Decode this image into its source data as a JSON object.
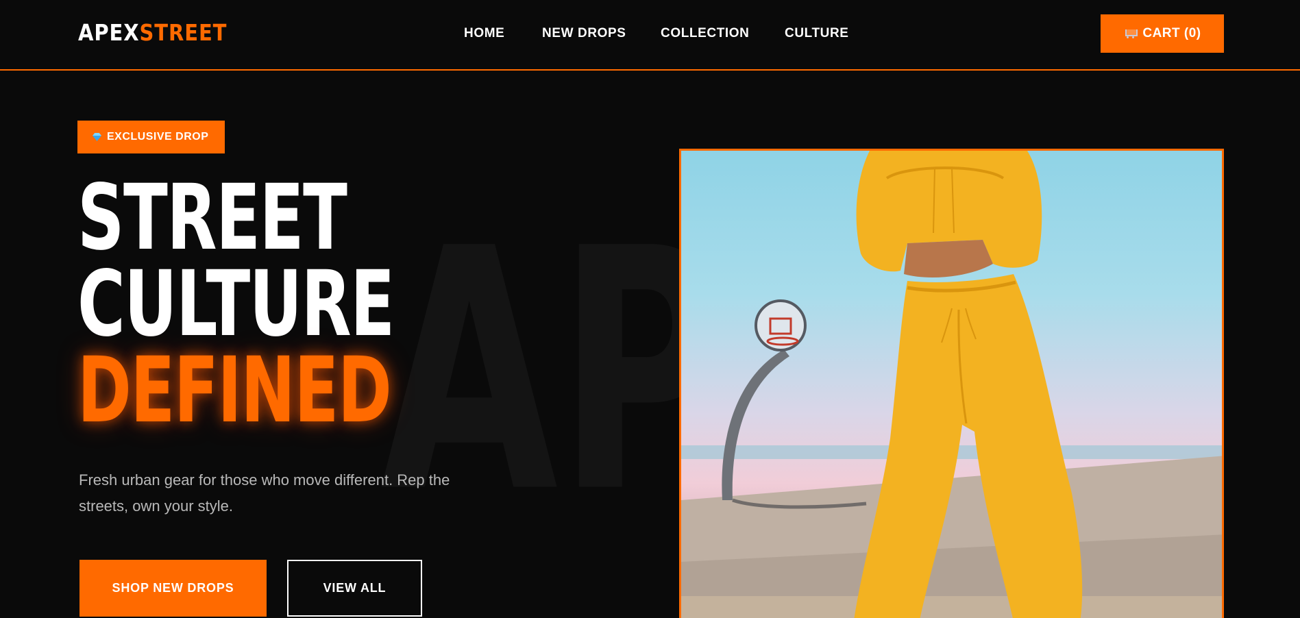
{
  "brand": {
    "part1": "APEX",
    "part2": "STREET"
  },
  "nav": [
    {
      "label": "HOME"
    },
    {
      "label": "NEW DROPS"
    },
    {
      "label": "COLLECTION"
    },
    {
      "label": "CULTURE"
    }
  ],
  "cart": {
    "label": "CART (0)",
    "icon": "cart-icon"
  },
  "hero": {
    "badge": {
      "icon": "gem-icon",
      "label": "EXCLUSIVE DROP"
    },
    "headline": {
      "line1": "STREET",
      "line2": "CULTURE",
      "line3": "DEFINED"
    },
    "watermark": "APEX",
    "subtitle": "Fresh urban gear for those who move different. Rep the streets, own your style.",
    "primary_button": "SHOP NEW DROPS",
    "secondary_button": "VIEW ALL",
    "image_alt": "Model in yellow hoodie and sweatpants on a basketball court"
  },
  "colors": {
    "accent": "#ff6a00",
    "background": "#0a0a0a",
    "text": "#ffffff",
    "muted": "#b9b9b9"
  }
}
